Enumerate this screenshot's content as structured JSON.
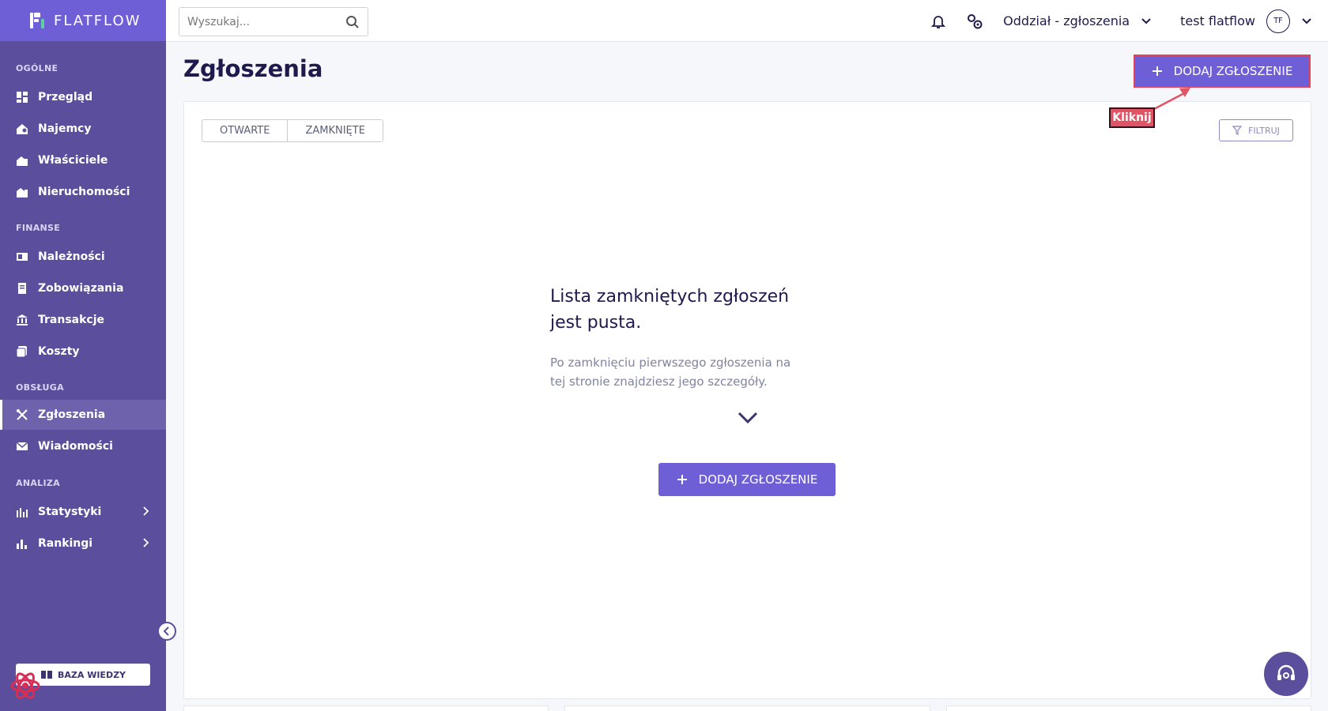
{
  "brand": {
    "name": "FLATFLOW",
    "colors": {
      "sidebar": "#5b4e9c",
      "accent": "#6f5fd6",
      "highlight": "#e05565"
    }
  },
  "topbar": {
    "search_placeholder": "Wyszukaj...",
    "branch": "Oddział - zgłoszenia",
    "user_name": "test flatflow",
    "user_initials": "TF"
  },
  "sidebar": {
    "sections": [
      {
        "title": "OGÓLNE",
        "items": [
          {
            "label": "Przegląd",
            "icon": "dashboard-icon"
          },
          {
            "label": "Najemcy",
            "icon": "tenants-icon"
          },
          {
            "label": "Właściciele",
            "icon": "owners-icon"
          },
          {
            "label": "Nieruchomości",
            "icon": "properties-icon"
          }
        ]
      },
      {
        "title": "FINANSE",
        "items": [
          {
            "label": "Należności",
            "icon": "receivables-icon"
          },
          {
            "label": "Zobowiązania",
            "icon": "liabilities-icon"
          },
          {
            "label": "Transakcje",
            "icon": "bank-icon"
          },
          {
            "label": "Koszty",
            "icon": "costs-icon"
          }
        ]
      },
      {
        "title": "OBSŁUGA",
        "items": [
          {
            "label": "Zgłoszenia",
            "icon": "tools-icon",
            "active": true
          },
          {
            "label": "Wiadomości",
            "icon": "mail-icon"
          }
        ]
      },
      {
        "title": "ANALIZA",
        "items": [
          {
            "label": "Statystyki",
            "icon": "stats-icon",
            "expandable": true
          },
          {
            "label": "Rankingi",
            "icon": "ranking-icon",
            "expandable": true
          }
        ]
      }
    ],
    "knowledge_base": "BAZA WIEDZY"
  },
  "main": {
    "title": "Zgłoszenia",
    "add_button": "DODAJ ZGŁOSZENIE",
    "tabs": [
      {
        "label": "OTWARTE"
      },
      {
        "label": "ZAMKNIĘTE"
      }
    ],
    "filter_button": "FILTRUJ",
    "empty_title_line1": "Lista zamkniętych zgłoszeń",
    "empty_title_line2": "jest pusta.",
    "empty_desc_line1": "Po zamknięciu pierwszego zgłoszenia na",
    "empty_desc_line2": "tej stronie znajdziesz jego szczegóły.",
    "empty_add_button": "DODAJ ZGŁOSZENIE"
  },
  "annotation": {
    "label": "Kliknij"
  }
}
